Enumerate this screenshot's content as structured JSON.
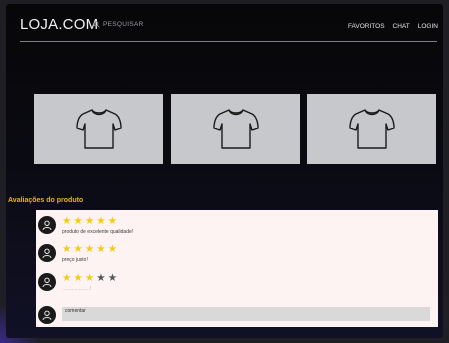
{
  "header": {
    "logo": "LOJA.COM",
    "search_placeholder": "PESQUISAR",
    "nav": [
      "FAVORITOS",
      "CHAT",
      "LOGIN"
    ]
  },
  "products": [
    {
      "image": "tshirt-icon"
    },
    {
      "image": "tshirt-icon"
    },
    {
      "image": "tshirt-icon"
    }
  ],
  "reviews": {
    "title": "Avaliações do produto",
    "items": [
      {
        "rating": 5,
        "max": 5,
        "text": "produto de excelente qualidade!"
      },
      {
        "rating": 5,
        "max": 5,
        "text": "preço justo!"
      },
      {
        "rating": 3,
        "max": 5,
        "text": "………………!"
      }
    ],
    "comment_placeholder": "comentar"
  },
  "colors": {
    "accent": "#e8b417",
    "star_on": "#f2cc13",
    "star_off": "#55565e",
    "review_panel": "#fdf3f2"
  }
}
